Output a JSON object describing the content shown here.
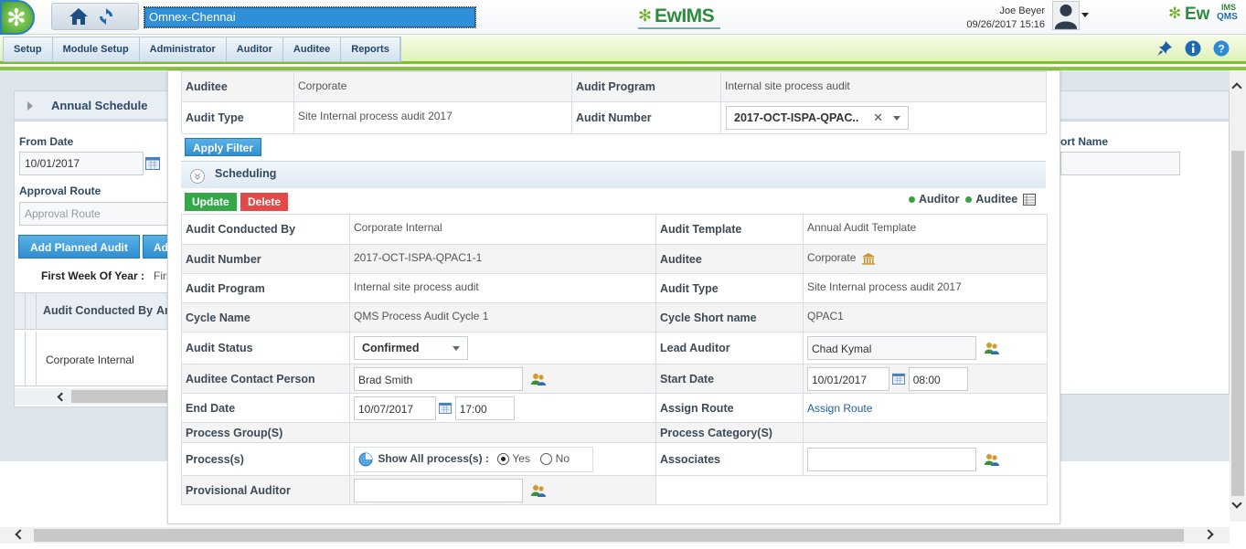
{
  "header": {
    "site": "Omnex-Chennai",
    "brand_center": "EwIMS",
    "brand_right_main": "Ew",
    "brand_right_sup": "IMS",
    "brand_right_sub": "QMS",
    "user_name": "Joe Beyer",
    "date_time": "09/26/2017 15:16"
  },
  "menu": [
    "Setup",
    "Module Setup",
    "Administrator",
    "Auditor",
    "Auditee",
    "Reports"
  ],
  "background_page": {
    "panel_title": "Annual Schedule",
    "from_date_label": "From Date",
    "from_date_value": "10/01/2017",
    "approval_route_label": "Approval Route",
    "approval_route_placeholder": "Approval Route",
    "add_planned_audit": "Add Planned Audit",
    "add_button_cut": "Ad",
    "short_name_label": "ort Name",
    "first_week_label": "First Week Of Year :",
    "first_week_value": "Firs",
    "grid_header": "Audit Conducted By",
    "grid_header_cut": "Ar",
    "grid_cell": "Corporate Internal"
  },
  "filter": {
    "auditee_label": "Auditee",
    "auditee_value": "Corporate",
    "program_label": "Audit Program",
    "program_value": "Internal site process audit",
    "type_label": "Audit Type",
    "type_value": "Site Internal process audit 2017",
    "number_label": "Audit Number",
    "number_value": "2017-OCT-ISPA-QPAC..",
    "apply_filter": "Apply Filter"
  },
  "scheduling": {
    "title": "Scheduling",
    "update": "Update",
    "delete": "Delete",
    "legend_auditor": "Auditor",
    "legend_auditee": "Auditee",
    "legend_color": "#3aa244"
  },
  "details": {
    "conducted_by_label": "Audit Conducted By",
    "conducted_by_value": "Corporate Internal",
    "template_label": "Audit Template",
    "template_value": "Annual Audit Template",
    "number_label": "Audit Number",
    "number_value": "2017-OCT-ISPA-QPAC1-1",
    "auditee_label": "Auditee",
    "auditee_value": "Corporate",
    "program_label": "Audit Program",
    "program_value": "Internal site process audit",
    "type_label": "Audit Type",
    "type_value": "Site Internal process audit 2017",
    "cycle_name_label": "Cycle Name",
    "cycle_name_value": "QMS Process Audit Cycle 1",
    "cycle_short_label": "Cycle Short name",
    "cycle_short_value": "QPAC1",
    "status_label": "Audit Status",
    "status_value": "Confirmed",
    "lead_auditor_label": "Lead Auditor",
    "lead_auditor_value": "Chad Kymal",
    "contact_label": "Auditee Contact Person",
    "contact_value": "Brad Smith",
    "start_date_label": "Start Date",
    "start_date_value": "10/01/2017",
    "start_time_value": "08:00",
    "end_date_label": "End Date",
    "end_date_value": "10/07/2017",
    "end_time_value": "17:00",
    "assign_route_label": "Assign Route",
    "assign_route_link": "Assign Route",
    "process_group_label": "Process Group(S)",
    "process_category_label": "Process Category(S)",
    "processes_label": "Process(s)",
    "show_all_label": "Show All process(s) :",
    "yes_label": "Yes",
    "no_label": "No",
    "show_all_selected": "Yes",
    "associates_label": "Associates",
    "provisional_label": "Provisional Auditor"
  }
}
